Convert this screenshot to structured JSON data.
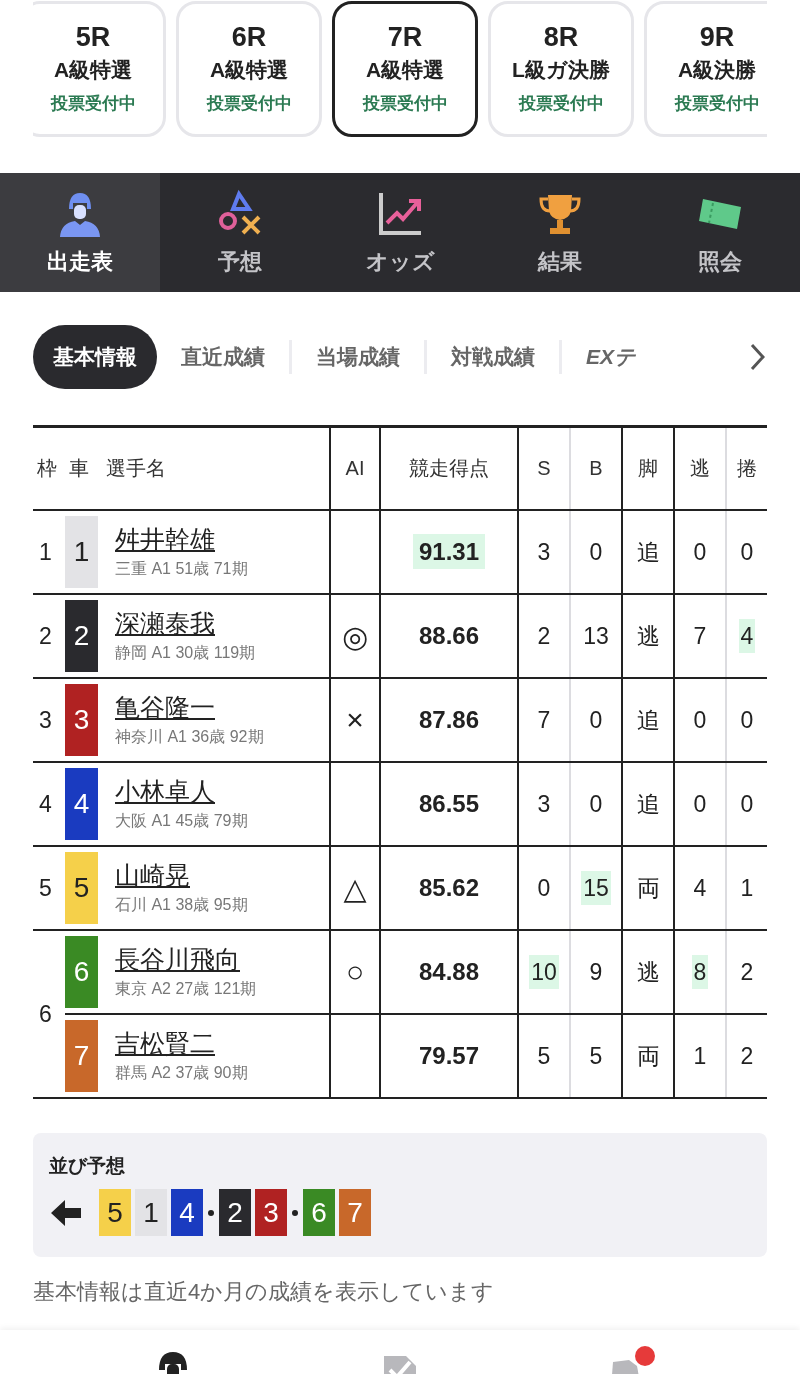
{
  "race_tabs": [
    {
      "race": "5R",
      "class": "A級特選",
      "status": "投票受付中",
      "selected": false
    },
    {
      "race": "6R",
      "class": "A級特選",
      "status": "投票受付中",
      "selected": false
    },
    {
      "race": "7R",
      "class": "A級特選",
      "status": "投票受付中",
      "selected": true
    },
    {
      "race": "8R",
      "class": "L級ガ決勝",
      "status": "投票受付中",
      "selected": false
    },
    {
      "race": "9R",
      "class": "A級決勝",
      "status": "投票受付中",
      "selected": false
    }
  ],
  "main_nav": [
    {
      "label": "出走表",
      "kind": "helmet",
      "selected": true
    },
    {
      "label": "予想",
      "kind": "marks",
      "selected": false
    },
    {
      "label": "オッズ",
      "kind": "chart",
      "selected": false
    },
    {
      "label": "結果",
      "kind": "trophy",
      "selected": false
    },
    {
      "label": "照会",
      "kind": "ticket",
      "selected": false
    }
  ],
  "sub_tabs": [
    {
      "label": "基本情報",
      "kind": "text",
      "selected": true
    },
    {
      "label": "直近成績",
      "kind": "text",
      "selected": false
    },
    {
      "label": "当場成績",
      "kind": "text",
      "selected": false
    },
    {
      "label": "対戦成績",
      "kind": "text",
      "selected": false
    },
    {
      "label": "EXテ",
      "kind": "brand",
      "selected": false
    }
  ],
  "entry_table": {
    "columns": [
      "枠",
      "車",
      "選手名",
      "AI",
      "競走得点",
      "S",
      "B",
      "脚",
      "逃",
      "捲"
    ],
    "frames": [
      {
        "frame": "1",
        "riders": [
          {
            "number": "1",
            "color": "#e3e3e6",
            "name": "舛井幹雄",
            "profile": "三重 A1 51歳 71期",
            "score": {
              "value": "91.31",
              "highlight": true
            },
            "stats": [
              {
                "value": "3",
                "highlight": false
              },
              {
                "value": "0",
                "highlight": false
              },
              {
                "value": "追",
                "highlight": false
              },
              {
                "value": "0",
                "highlight": false
              },
              {
                "value": "0",
                "highlight": false
              }
            ]
          }
        ]
      },
      {
        "frame": "2",
        "riders": [
          {
            "number": "2",
            "color": "#2a2a2e",
            "name": "深瀬泰我",
            "profile": "静岡 A1 30歳 119期",
            "ai": "◎",
            "score": {
              "value": "88.66",
              "highlight": false
            },
            "stats": [
              {
                "value": "2",
                "highlight": false
              },
              {
                "value": "13",
                "highlight": false
              },
              {
                "value": "逃",
                "highlight": false
              },
              {
                "value": "7",
                "highlight": false
              },
              {
                "value": "4",
                "highlight": true
              }
            ]
          }
        ]
      },
      {
        "frame": "3",
        "riders": [
          {
            "number": "3",
            "color": "#b02222",
            "name": "亀谷隆一",
            "profile": "神奈川 A1 36歳 92期",
            "ai": "×",
            "score": {
              "value": "87.86",
              "highlight": false
            },
            "stats": [
              {
                "value": "7",
                "highlight": false
              },
              {
                "value": "0",
                "highlight": false
              },
              {
                "value": "追",
                "highlight": false
              },
              {
                "value": "0",
                "highlight": false
              },
              {
                "value": "0",
                "highlight": false
              }
            ]
          }
        ]
      },
      {
        "frame": "4",
        "riders": [
          {
            "number": "4",
            "color": "#1a3bc0",
            "name": "小林卓人",
            "profile": "大阪 A1 45歳 79期",
            "score": {
              "value": "86.55",
              "highlight": false
            },
            "stats": [
              {
                "value": "3",
                "highlight": false
              },
              {
                "value": "0",
                "highlight": false
              },
              {
                "value": "追",
                "highlight": false
              },
              {
                "value": "0",
                "highlight": false
              },
              {
                "value": "0",
                "highlight": false
              }
            ]
          }
        ]
      },
      {
        "frame": "5",
        "riders": [
          {
            "number": "5",
            "color": "#f5d04a",
            "name": "山崎晃",
            "profile": "石川 A1 38歳 95期",
            "ai": "△",
            "score": {
              "value": "85.62",
              "highlight": false
            },
            "stats": [
              {
                "value": "0",
                "highlight": false
              },
              {
                "value": "15",
                "highlight": true
              },
              {
                "value": "両",
                "highlight": false
              },
              {
                "value": "4",
                "highlight": false
              },
              {
                "value": "1",
                "highlight": false
              }
            ]
          }
        ]
      },
      {
        "frame": "6",
        "riders": [
          {
            "number": "6",
            "color": "#3a8a24",
            "name": "長谷川飛向",
            "profile": "東京 A2 27歳 121期",
            "ai": "○",
            "score": {
              "value": "84.88",
              "highlight": false
            },
            "stats": [
              {
                "value": "10",
                "highlight": true
              },
              {
                "value": "9",
                "highlight": false
              },
              {
                "value": "逃",
                "highlight": false
              },
              {
                "value": "8",
                "highlight": true
              },
              {
                "value": "2",
                "highlight": false
              }
            ]
          },
          {
            "number": "7",
            "color": "#c8682a",
            "name": "吉松賢二",
            "profile": "群馬 A2 37歳 90期",
            "score": {
              "value": "79.57",
              "highlight": false
            },
            "stats": [
              {
                "value": "5",
                "highlight": false
              },
              {
                "value": "5",
                "highlight": false
              },
              {
                "value": "両",
                "highlight": false
              },
              {
                "value": "1",
                "highlight": false
              },
              {
                "value": "2",
                "highlight": false
              }
            ]
          }
        ]
      }
    ]
  },
  "line_prediction": {
    "title": "並び予想",
    "groups": [
      {
        "bikes": [
          {
            "number": "5",
            "color": "#f5d04a"
          },
          {
            "number": "1",
            "color": "#e3e3e6"
          },
          {
            "number": "4",
            "color": "#1a3bc0"
          }
        ]
      },
      {
        "bikes": [
          {
            "number": "2",
            "color": "#2a2a2e"
          },
          {
            "number": "3",
            "color": "#b02222"
          }
        ]
      },
      {
        "bikes": [
          {
            "number": "6",
            "color": "#3a8a24"
          },
          {
            "number": "7",
            "color": "#c8682a"
          }
        ]
      }
    ]
  },
  "note": "基本情報は直近4か月の成績を表示しています",
  "bottom_nav": [
    {
      "kind": "helmet",
      "badge": false
    },
    {
      "kind": "check",
      "badge": false
    },
    {
      "kind": "bike",
      "badge": true
    }
  ]
}
